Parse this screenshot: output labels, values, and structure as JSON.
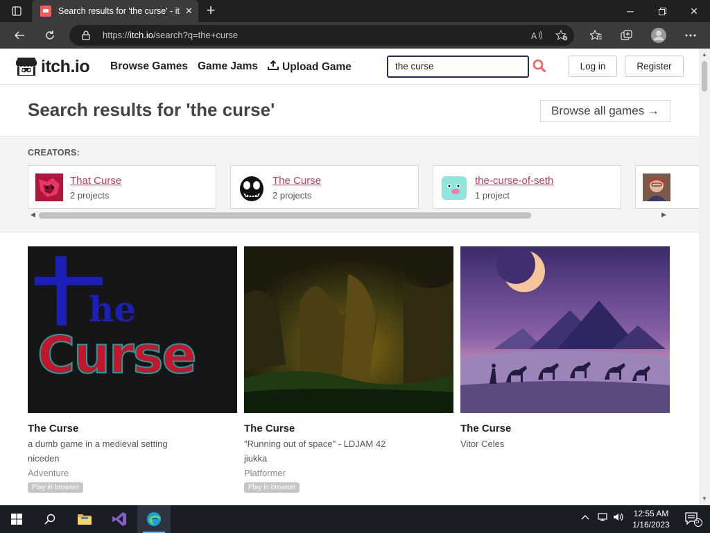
{
  "browser": {
    "tab_title": "Search results for 'the curse' - itch.io",
    "url_host": "itch.io",
    "url_prefix": "https://",
    "url_path": "/search?q=the+curse"
  },
  "site": {
    "logo_text": "itch.io",
    "nav": {
      "browse_games": "Browse Games",
      "game_jams": "Game Jams",
      "upload_game": "Upload Game"
    },
    "search_value": "the curse",
    "login_label": "Log in",
    "register_label": "Register",
    "accent_color": "#fa5c5c"
  },
  "results": {
    "title": "Search results for 'the curse'",
    "browse_all_label": "Browse all games →",
    "creators_label": "CREATORS:",
    "creators": [
      {
        "name": "That Curse",
        "count": "2 projects"
      },
      {
        "name": "The Curse",
        "count": "2 projects"
      },
      {
        "name": "the-curse-of-seth",
        "count": "1 project"
      },
      {
        "name": "",
        "count": ""
      }
    ],
    "games": [
      {
        "title": "The Curse",
        "desc": "a dumb game in a medieval setting",
        "author": "niceden",
        "genre": "Adventure",
        "badge": "Play in browser"
      },
      {
        "title": "The Curse",
        "desc": "\"Running out of space\" - LDJAM 42",
        "author": "jiukka",
        "genre": "Platformer",
        "badge": "Play in browser"
      },
      {
        "title": "The Curse",
        "desc": "Vitor Celes"
      }
    ]
  },
  "taskbar": {
    "time": "12:55 AM",
    "date": "1/16/2023",
    "notification_count": "5"
  }
}
